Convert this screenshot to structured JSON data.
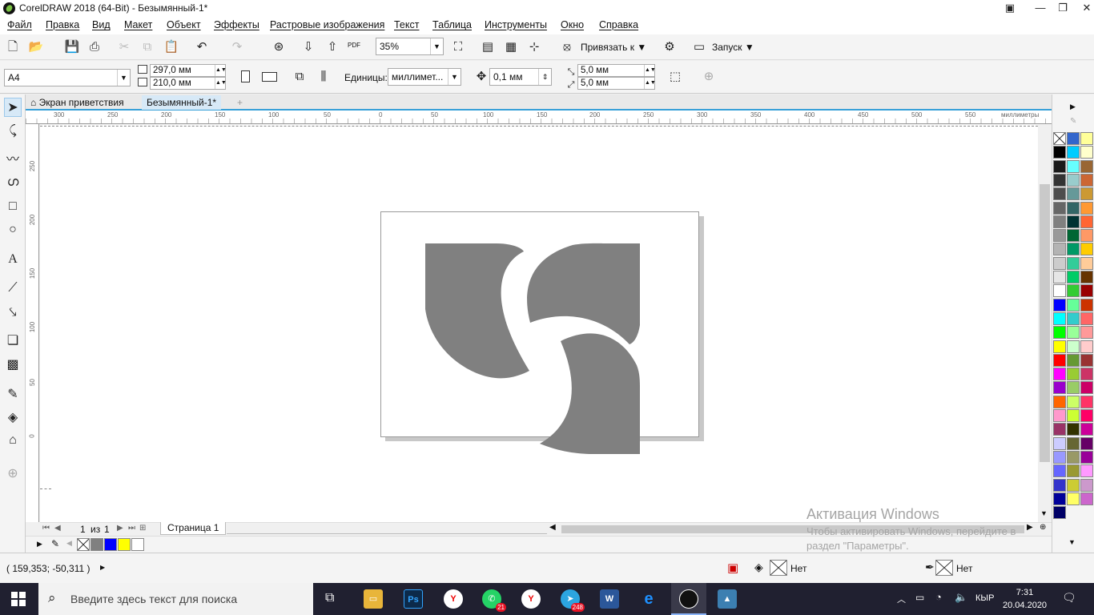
{
  "window": {
    "title": "CorelDRAW 2018 (64-Bit) - Безымянный-1*"
  },
  "menu": [
    "Файл",
    "Правка",
    "Вид",
    "Макет",
    "Объект",
    "Эффекты",
    "Растровые изображения",
    "Текст",
    "Таблица",
    "Инструменты",
    "Окно",
    "Справка"
  ],
  "toolbar": {
    "zoom": "35%",
    "snap_label": "Привязать к",
    "launch_label": "Запуск",
    "pdf_label": "PDF"
  },
  "propbar": {
    "page_size": "A4",
    "width": "297,0 мм",
    "height": "210,0 мм",
    "units_label": "Единицы:",
    "units_value": "миллимет...",
    "nudge": "0,1 мм",
    "dup_x": "5,0 мм",
    "dup_y": "5,0 мм"
  },
  "tabs": {
    "welcome": "Экран приветствия",
    "doc": "Безымянный-1*"
  },
  "ruler": {
    "unit": "миллиметры",
    "h_ticks": [
      "300",
      "250",
      "200",
      "150",
      "100",
      "50",
      "0",
      "50",
      "100",
      "150",
      "200",
      "250",
      "300",
      "350",
      "400",
      "450",
      "500",
      "550"
    ],
    "v_ticks": [
      "250",
      "200",
      "150",
      "100",
      "50",
      "0"
    ]
  },
  "pagenav": {
    "current": "1",
    "of_label": "из",
    "total": "1",
    "page_tab": "Страница 1"
  },
  "status": {
    "coords": "( 159,353; -50,311 )",
    "fill_none": "Нет",
    "outline_none": "Нет"
  },
  "watermark": {
    "title": "Активация Windows",
    "line1": "Чтобы активировать Windows, перейдите в",
    "line2": "раздел \"Параметры\"."
  },
  "taskbar": {
    "search_placeholder": "Введите здесь текст для поиска",
    "time": "7:31",
    "date": "20.04.2020",
    "lang": "КЫР",
    "whatsapp_badge": "21",
    "telegram_badge": "248"
  },
  "colors": {
    "shape_fill": "#808080",
    "accent": "#37a0d8"
  }
}
